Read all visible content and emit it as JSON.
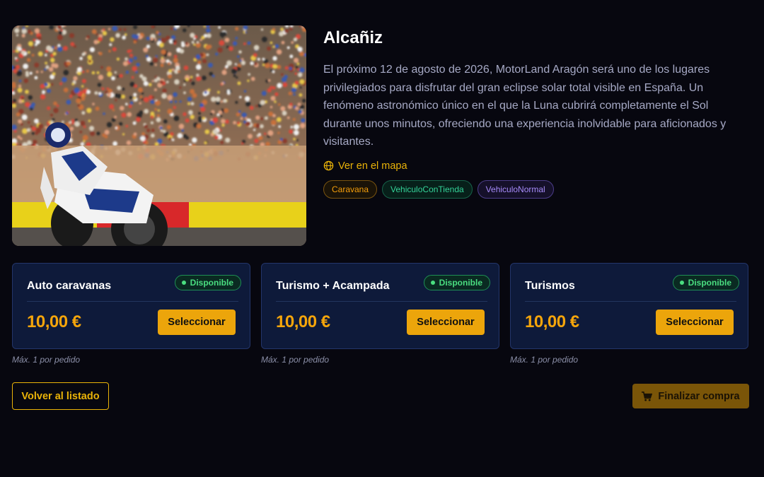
{
  "event": {
    "title": "Alcañiz",
    "description": "El próximo 12 de agosto de 2026, MotorLand Aragón será uno de los lugares privilegiados para disfrutar del gran eclipse solar total visible en España. Un fenómeno astronómico único en el que la Luna cubrirá completamente el Sol durante unos minutos, ofreciendo una experiencia inolvidable para aficionados y visitantes.",
    "map_link": "Ver en el mapa",
    "image_icon": "motorcycle-racing-photo",
    "tags": [
      "Caravana",
      "VehiculoConTienda",
      "VehiculoNormal"
    ]
  },
  "tickets": [
    {
      "name": "Auto caravanas",
      "status": "Disponible",
      "price": "10,00 €",
      "button": "Seleccionar",
      "note": "Máx. 1 por pedido"
    },
    {
      "name": "Turismo + Acampada",
      "status": "Disponible",
      "price": "10,00 €",
      "button": "Seleccionar",
      "note": "Máx. 1 por pedido"
    },
    {
      "name": "Turismos",
      "status": "Disponible",
      "price": "10,00 €",
      "button": "Seleccionar",
      "note": "Máx. 1 por pedido"
    }
  ],
  "actions": {
    "back": "Volver al listado",
    "checkout": "Finalizar compra"
  },
  "colors": {
    "accent": "#eab308",
    "available": "#4ade80",
    "card_bg": "#0e1a3a",
    "page_bg": "#07070f"
  }
}
